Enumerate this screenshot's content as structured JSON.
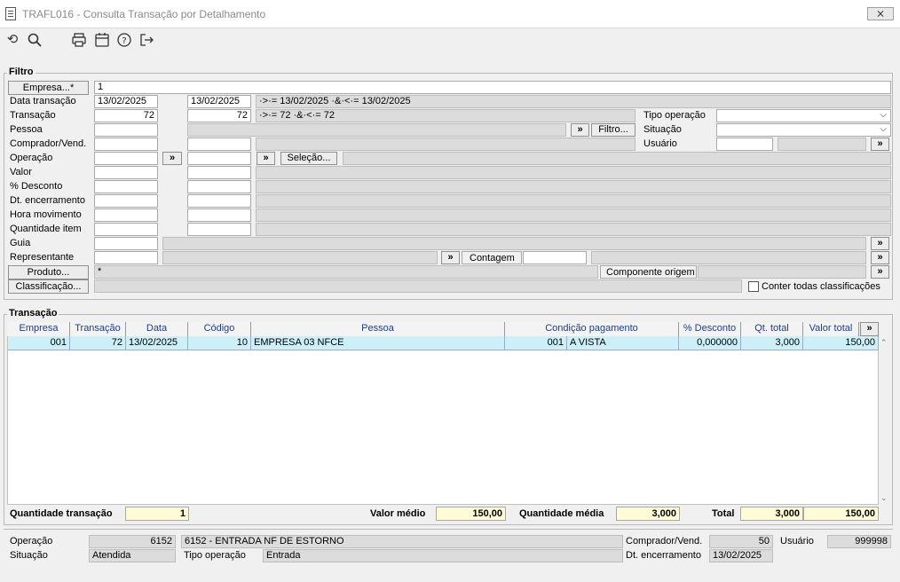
{
  "window": {
    "title": "TRAFL016 - Consulta Transação por Detalhamento",
    "close": "⨯"
  },
  "filtro": {
    "group_label": "Filtro",
    "empresa_btn": "Empresa...*",
    "empresa_value": "1",
    "labels": {
      "data_transacao": "Data transação",
      "transacao": "Transação",
      "pessoa": "Pessoa",
      "comprador": "Comprador/Vend.",
      "operacao": "Operação",
      "valor": "Valor",
      "desconto": "% Desconto",
      "dt_encerramento": "Dt. encerramento",
      "hora_movimento": "Hora movimento",
      "quantidade_item": "Quantidade item",
      "guia": "Guia",
      "representante": "Representante"
    },
    "data_de": "13/02/2025",
    "data_ate": "13/02/2025",
    "data_expr": "·>·= 13/02/2025 ·&·<·= 13/02/2025",
    "transacao_de": "72",
    "transacao_ate": "72",
    "transacao_expr": "·>·= 72 ·&·<·= 72",
    "tipo_operacao_label": "Tipo operação",
    "situacao_label": "Situação",
    "usuario_label": "Usuário",
    "filtro_btn": "Filtro...",
    "selecao_btn": "Seleção...",
    "contagem_label": "Contagem",
    "produto_btn": "Produto...",
    "produto_value": "*",
    "componente_label": "Componente origem",
    "classificacao_btn": "Classificação...",
    "conter_label": "Conter todas classificações",
    "arrow": "»"
  },
  "transacao": {
    "group_label": "Transação",
    "columns": [
      "Empresa",
      "Transação",
      "Data",
      "Código",
      "Pessoa",
      "Condição pagamento",
      "% Desconto",
      "Qt. total",
      "Valor total"
    ],
    "rows": [
      {
        "empresa": "001",
        "transacao": "72",
        "data": "13/02/2025",
        "codigo": "10",
        "pessoa": "EMPRESA 03 NFCE",
        "cond_codigo": "001",
        "cond_nome": "A VISTA",
        "desconto": "0,000000",
        "qt_total": "3,000",
        "valor_total": "150,00"
      }
    ]
  },
  "summary": {
    "qtd_transacao_label": "Quantidade transação",
    "qtd_transacao": "1",
    "valor_medio_label": "Valor médio",
    "valor_medio": "150,00",
    "qtd_media_label": "Quantidade média",
    "qtd_media": "3,000",
    "total_label": "Total",
    "total_qt": "3,000",
    "total_valor": "150,00"
  },
  "details": {
    "operacao_label": "Operação",
    "operacao_codigo": "6152",
    "operacao_nome": "6152 - ENTRADA NF DE ESTORNO",
    "comprador_label": "Comprador/Vend.",
    "comprador_value": "50",
    "usuario_label": "Usuário",
    "usuario_value": "999998",
    "situacao_label": "Situação",
    "situacao_value": "Atendida",
    "tipo_operacao_label": "Tipo operação",
    "tipo_operacao_value": "Entrada",
    "dt_encerramento_label": "Dt. encerramento",
    "dt_encerramento_value": "13/02/2025"
  }
}
